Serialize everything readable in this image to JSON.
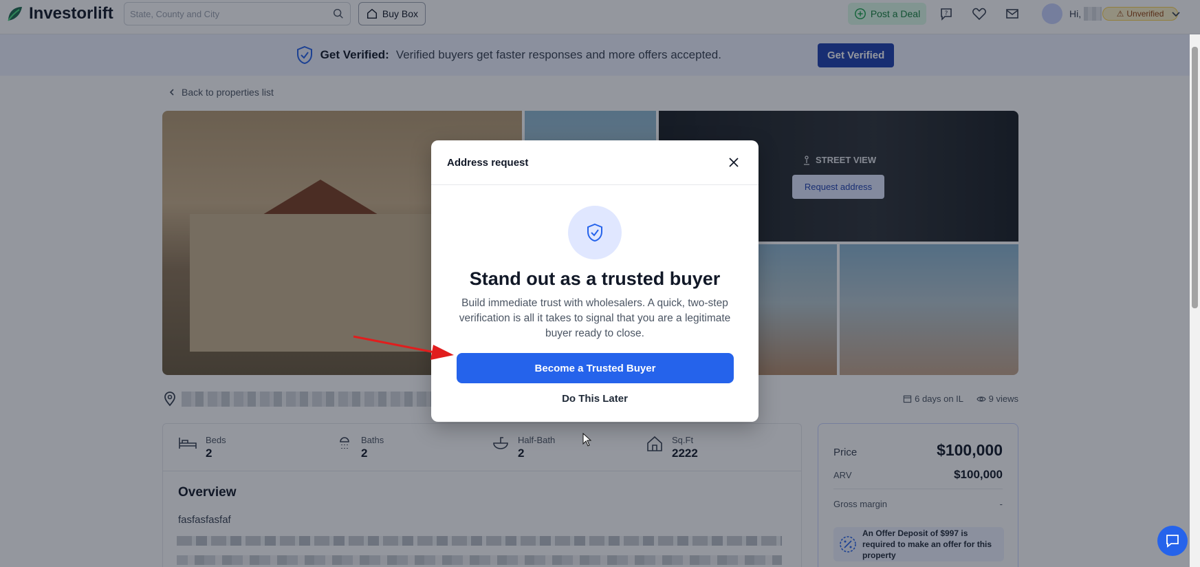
{
  "nav": {
    "logo_text": "Investorlift",
    "search_placeholder": "State, County and City",
    "buy_box": "Buy Box",
    "post_deal": "Post a Deal",
    "greeting": "Hi,",
    "unverified": "Unverified"
  },
  "banner": {
    "title": "Get Verified:",
    "text": "Verified buyers get faster responses and more offers accepted.",
    "button": "Get Verified"
  },
  "back_link": "Back to properties list",
  "gallery": {
    "street_view": "STREET VIEW",
    "request_address": "Request address"
  },
  "listing_meta": {
    "days": "6 days on IL",
    "views": "9 views"
  },
  "stats": [
    {
      "label": "Beds",
      "value": "2"
    },
    {
      "label": "Baths",
      "value": "2"
    },
    {
      "label": "Half-Bath",
      "value": "2"
    },
    {
      "label": "Sq.Ft",
      "value": "2222"
    }
  ],
  "overview": {
    "title": "Overview",
    "description": "fasfasfasfaf"
  },
  "pricing": {
    "price_label": "Price",
    "price_value": "$100,000",
    "arv_label": "ARV",
    "arv_value": "$100,000",
    "margin_label": "Gross margin",
    "margin_value": "-",
    "deposit_note": "An Offer Deposit of $997 is required to make an offer for this property"
  },
  "modal": {
    "title": "Address request",
    "heading": "Stand out as a trusted buyer",
    "body": "Build immediate trust with wholesalers. A quick, two-step verification is all it takes to signal that you are a legitimate buyer ready to close.",
    "primary_button": "Become a Trusted Buyer",
    "secondary_button": "Do This Later"
  },
  "colors": {
    "primary": "#2563eb",
    "banner_button": "#1e40af",
    "post_deal_bg": "#dcfce7",
    "unverified_bg": "#fef3c7",
    "annotation_arrow": "#e11d1d"
  }
}
